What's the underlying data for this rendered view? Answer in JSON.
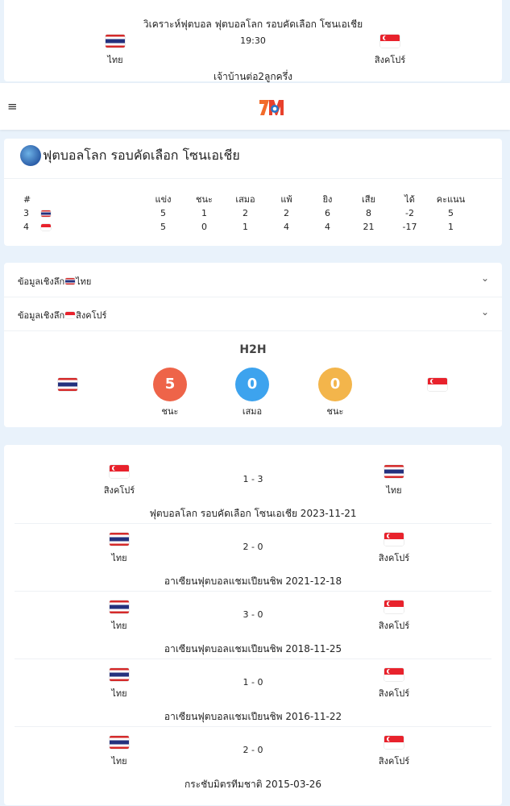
{
  "match": {
    "title": "วิเคราะห์ฟุตบอล ฟุตบอลโลก รอบคัดเลือก โซนเอเชีย",
    "time": "19:30",
    "home": "ไทย",
    "away": "สิงคโปร์",
    "handicap": "เจ้าบ้านต่อ2ลูกครึ่ง"
  },
  "header": {
    "menu_icon": "≡",
    "logo": "7M"
  },
  "standings": {
    "league": "ฟุตบอลโลก รอบคัดเลือก โซนเอเชีย",
    "columns": [
      "#",
      "แข่ง",
      "ชนะ",
      "เสมอ",
      "แพ้",
      "ยิง",
      "เสีย",
      "ได้",
      "คะแนน"
    ],
    "rows": [
      {
        "rank": "3",
        "team": "thailand",
        "played": "5",
        "win": "1",
        "draw": "2",
        "loss": "2",
        "gf": "6",
        "ga": "8",
        "gd": "-2",
        "pts": "5"
      },
      {
        "rank": "4",
        "team": "singapore",
        "played": "5",
        "win": "0",
        "draw": "1",
        "loss": "4",
        "gf": "4",
        "ga": "21",
        "gd": "-17",
        "pts": "1"
      }
    ]
  },
  "info": {
    "acc1_prefix": "ข้อมูลเชิงลึก",
    "acc1_team": "ไทย",
    "acc2_prefix": "ข้อมูลเชิงลึก",
    "acc2_team": "สิงคโปร์",
    "h2h_title": "H2H",
    "h2h": {
      "home_win": "5",
      "home_win_label": "ชนะ",
      "draw": "0",
      "draw_label": "เสมอ",
      "away_win": "0",
      "away_win_label": "ชนะ"
    }
  },
  "history": [
    {
      "home": "สิงคโปร์",
      "home_flag": "singapore",
      "away": "ไทย",
      "away_flag": "thailand",
      "score": "1 - 3",
      "comp": "ฟุตบอลโลก รอบคัดเลือก โซนเอเชีย 2023-11-21"
    },
    {
      "home": "ไทย",
      "home_flag": "thailand",
      "away": "สิงคโปร์",
      "away_flag": "singapore",
      "score": "2 - 0",
      "comp": "อาเซียนฟุตบอลแชมเปียนชิพ 2021-12-18"
    },
    {
      "home": "ไทย",
      "home_flag": "thailand",
      "away": "สิงคโปร์",
      "away_flag": "singapore",
      "score": "3 - 0",
      "comp": "อาเซียนฟุตบอลแชมเปียนชิพ 2018-11-25"
    },
    {
      "home": "ไทย",
      "home_flag": "thailand",
      "away": "สิงคโปร์",
      "away_flag": "singapore",
      "score": "1 - 0",
      "comp": "อาเซียนฟุตบอลแชมเปียนชิพ 2016-11-22"
    },
    {
      "home": "ไทย",
      "home_flag": "thailand",
      "away": "สิงคโปร์",
      "away_flag": "singapore",
      "score": "2 - 0",
      "comp": "กระชับมิตรทีมชาติ 2015-03-26"
    }
  ],
  "colors": {
    "win": "#ee6449",
    "draw": "#3da3ee",
    "away": "#f3b54b",
    "background": "#e9f2fb"
  }
}
